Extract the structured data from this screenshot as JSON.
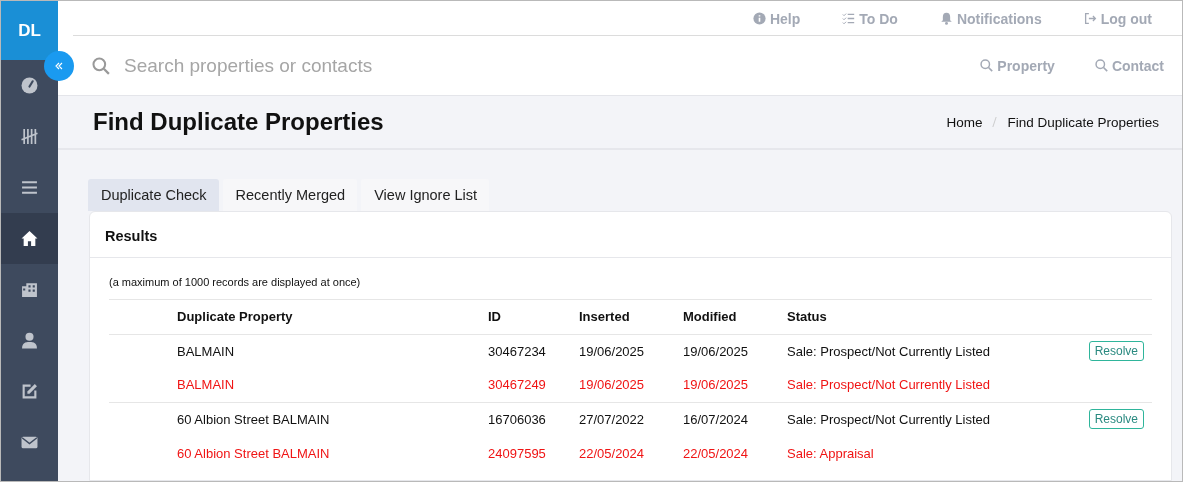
{
  "sidebar": {
    "initials": "DL",
    "items": [
      {
        "selected": false
      },
      {
        "selected": false
      },
      {
        "selected": false
      },
      {
        "selected": true
      },
      {
        "selected": false
      },
      {
        "selected": false
      },
      {
        "selected": false
      },
      {
        "selected": false
      }
    ]
  },
  "top_links": [
    {
      "label": "Help"
    },
    {
      "label": "To Do"
    },
    {
      "label": "Notifications"
    },
    {
      "label": "Log out"
    }
  ],
  "search": {
    "placeholder": "Search properties or contacts",
    "buttons": [
      "Property",
      "Contact"
    ]
  },
  "page": {
    "title": "Find Duplicate Properties",
    "breadcrumb": [
      "Home",
      "Find Duplicate Properties"
    ]
  },
  "tabs": [
    {
      "label": "Duplicate Check",
      "selected": true
    },
    {
      "label": "Recently Merged",
      "selected": false
    },
    {
      "label": "View Ignore List",
      "selected": false
    }
  ],
  "results": {
    "title": "Results",
    "note": "(a maximum of 1000 records are displayed at once)",
    "columns": [
      "Duplicate Property",
      "ID",
      "Inserted",
      "Modified",
      "Status"
    ],
    "groups": [
      {
        "action": "Resolve",
        "rows": [
          {
            "kind": "original",
            "cells": [
              "BALMAIN",
              "30467234",
              "19/06/2025",
              "19/06/2025",
              "Sale: Prospect/Not Currently Listed"
            ]
          },
          {
            "kind": "duplicate",
            "cells": [
              "BALMAIN",
              "30467249",
              "19/06/2025",
              "19/06/2025",
              "Sale: Prospect/Not Currently Listed"
            ]
          }
        ]
      },
      {
        "action": "Resolve",
        "rows": [
          {
            "kind": "original",
            "cells": [
              "60 Albion Street BALMAIN",
              "16706036",
              "27/07/2022",
              "16/07/2024",
              "Sale: Prospect/Not Currently Listed"
            ]
          },
          {
            "kind": "duplicate",
            "cells": [
              "60 Albion Street BALMAIN",
              "24097595",
              "22/05/2024",
              "22/05/2024",
              "Sale: Appraisal"
            ]
          }
        ]
      }
    ]
  }
}
